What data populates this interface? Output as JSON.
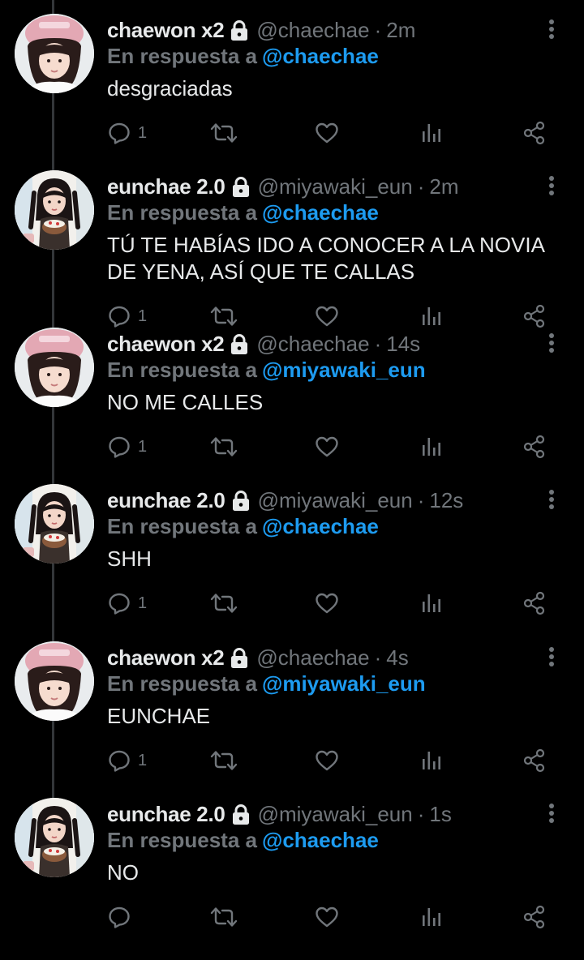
{
  "colors": {
    "background": "#000000",
    "text_primary": "#e7e9ea",
    "text_secondary": "#71767b",
    "link": "#1d9bf0",
    "thread_line": "#333639"
  },
  "icons": {
    "lock": "lock-icon",
    "more": "more-vertical-icon",
    "reply": "reply-icon",
    "retweet": "retweet-icon",
    "like": "heart-icon",
    "views": "analytics-icon",
    "share": "share-icon"
  },
  "reply_prefix": "En respuesta a",
  "tweets": [
    {
      "display_name": "chaewon x2",
      "handle": "@chaechae",
      "separator": "·",
      "time": "2m",
      "reply_to": "@chaechae",
      "text": "desgraciadas",
      "reply_count": "1",
      "avatar": "chaewon"
    },
    {
      "display_name": "eunchae 2.0",
      "handle": "@miyawaki_eun",
      "separator": "·",
      "time": "2m",
      "reply_to": "@chaechae",
      "text": "TÚ TE HABÍAS IDO A CONOCER A LA NOVIA DE YENA, ASÍ QUE TE CALLAS",
      "reply_count": "1",
      "avatar": "eunchae"
    },
    {
      "display_name": "chaewon x2",
      "handle": "@chaechae",
      "separator": "·",
      "time": "14s",
      "reply_to": "@miyawaki_eun",
      "text": "NO ME CALLES",
      "reply_count": "1",
      "avatar": "chaewon"
    },
    {
      "display_name": "eunchae 2.0",
      "handle": "@miyawaki_eun",
      "separator": "·",
      "time": "12s",
      "reply_to": "@chaechae",
      "text": "SHH",
      "reply_count": "1",
      "avatar": "eunchae"
    },
    {
      "display_name": "chaewon x2",
      "handle": "@chaechae",
      "separator": "·",
      "time": "4s",
      "reply_to": "@miyawaki_eun",
      "text": "EUNCHAE",
      "reply_count": "1",
      "avatar": "chaewon"
    },
    {
      "display_name": "eunchae 2.0",
      "handle": "@miyawaki_eun",
      "separator": "·",
      "time": "1s",
      "reply_to": "@chaechae",
      "text": "NO",
      "reply_count": "",
      "avatar": "eunchae"
    }
  ]
}
